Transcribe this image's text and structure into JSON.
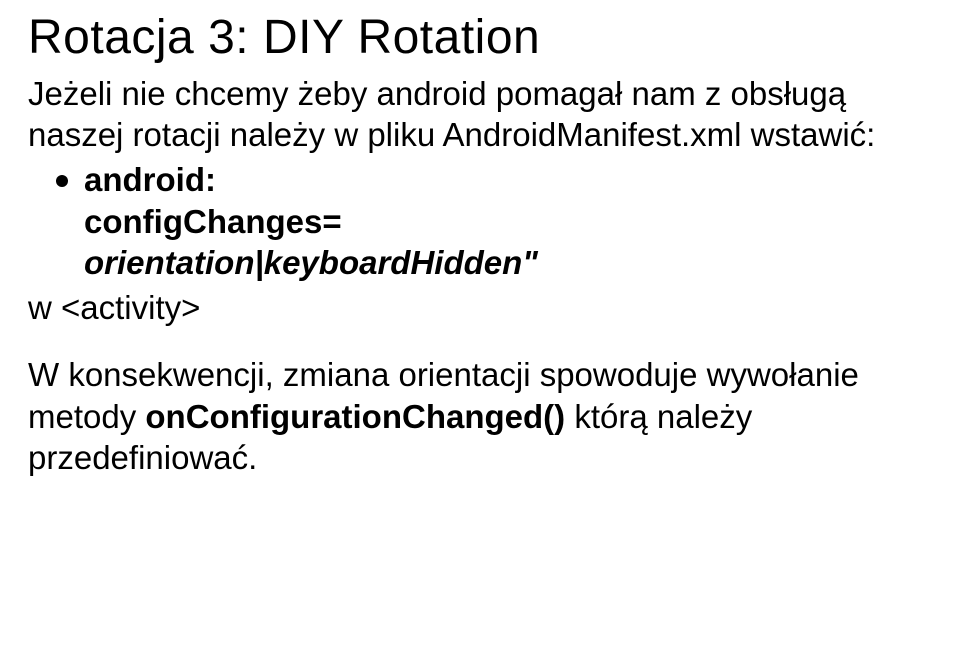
{
  "title": "Rotacja 3: DIY Rotation",
  "intro1": "Jeżeli nie chcemy żeby android pomagał nam z obsługą naszej rotacji należy w pliku ",
  "manifest": "AndroidManifest.xml",
  "intro2": " wstawić:",
  "bullet_line1": "android:",
  "bullet_cfg": "configChanges=",
  "bullet_quote_right": "\"",
  "bullet_val": "orientation|keyboardHidden\"",
  "activity_prefix": "w ",
  "activity_tag": "<activity>",
  "conseq_1": "W konsekwencji, zmiana orientacji spowoduje wywołanie metody ",
  "conseq_method": "onConfigurationChanged()",
  "conseq_2": " którą należy przedefiniować."
}
